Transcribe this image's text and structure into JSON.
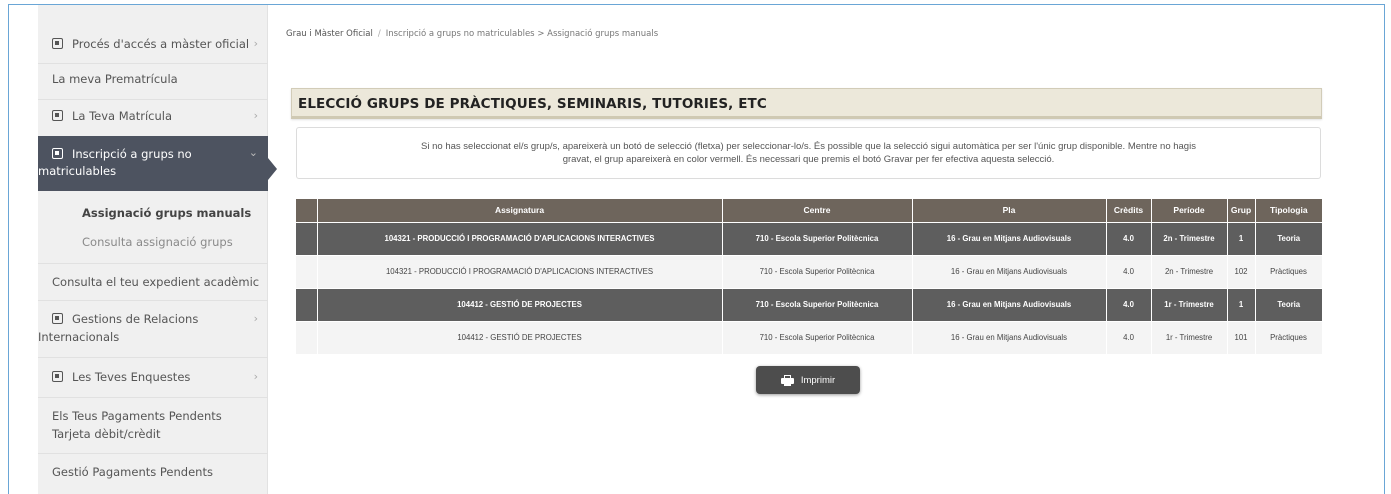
{
  "sidebar": {
    "items": [
      {
        "label": "Procés d'accés a màster oficial",
        "icon": "expand-box-icon",
        "chevron": "›"
      },
      {
        "label": "La meva Prematrícula"
      },
      {
        "label": "La Teva Matrícula",
        "icon": "expand-box-icon",
        "chevron": "›"
      },
      {
        "label_line1": "Inscripció a grups no",
        "label_line2": "matriculables",
        "icon": "expand-box-icon",
        "chevron": "⌄",
        "active": true
      },
      {
        "label": "Consulta el teu expedient acadèmic"
      },
      {
        "label_line1": "Gestions de Relacions",
        "label_line2": "Internacionals",
        "icon": "expand-box-icon",
        "chevron": "›"
      },
      {
        "label": "Les Teves Enquestes",
        "icon": "expand-box-icon",
        "chevron": "›"
      },
      {
        "label_line1": "Els Teus Pagaments Pendents",
        "label_line2": "Tarjeta dèbit/crèdit"
      },
      {
        "label": "Gestió Pagaments Pendents"
      }
    ],
    "subitems": [
      {
        "label": "Assignació grups manuals",
        "selected": true
      },
      {
        "label": "Consulta assignació grups",
        "selected": false
      }
    ]
  },
  "breadcrumb": {
    "root": "Grau i Màster Oficial",
    "separator": "/",
    "path": "Inscripció a grups no matriculables > Assignació grups manuals"
  },
  "main": {
    "title": "ELECCIÓ GRUPS DE PRÀCTIQUES, SEMINARIS, TUTORIES, ETC",
    "notice_line1": "Si no has seleccionat el/s grup/s, apareixerà un botó de selecció (fletxa) per seleccionar-lo/s. És possible que la selecció sigui automàtica per ser l'únic grup disponible. Mentre no hagis",
    "notice_line2": "gravat, el grup apareixerà en color vermell. És necessari que premis el botó Gravar per fer efectiva aquesta selecció.",
    "print_label": "Imprimir"
  },
  "table": {
    "columns": [
      "",
      "Assignatura",
      "Centre",
      "Pla",
      "Crèdits",
      "Període",
      "Grup",
      "Tipologia"
    ],
    "rows": [
      {
        "style": "dark",
        "cells": [
          "",
          "104321 - PRODUCCIÓ I PROGRAMACIÓ D'APLICACIONS INTERACTIVES",
          "710 - Escola Superior Politècnica",
          "16 - Grau en Mitjans Audiovisuals",
          "4.0",
          "2n - Trimestre",
          "1",
          "Teoria"
        ]
      },
      {
        "style": "light",
        "cells": [
          "",
          "104321 - PRODUCCIÓ I PROGRAMACIÓ D'APLICACIONS INTERACTIVES",
          "710 - Escola Superior Politècnica",
          "16 - Grau en Mitjans Audiovisuals",
          "4.0",
          "2n - Trimestre",
          "102",
          "Pràctiques"
        ]
      },
      {
        "style": "dark",
        "cells": [
          "",
          "104412 - GESTIÓ DE PROJECTES",
          "710 - Escola Superior Politècnica",
          "16 - Grau en Mitjans Audiovisuals",
          "4.0",
          "1r - Trimestre",
          "1",
          "Teoria"
        ]
      },
      {
        "style": "light",
        "cells": [
          "",
          "104412 - GESTIÓ DE PROJECTES",
          "710 - Escola Superior Politècnica",
          "16 - Grau en Mitjans Audiovisuals",
          "4.0",
          "1r - Trimestre",
          "101",
          "Pràctiques"
        ]
      }
    ]
  },
  "colors": {
    "sidebar_bg": "#f0f0f0",
    "sidebar_active": "#4d5360",
    "table_header": "#6e655c",
    "row_dark": "#5e5e5e",
    "row_light": "#f4f4f4",
    "title_panel": "#ece8da",
    "frame_border": "#6aa6d6"
  }
}
